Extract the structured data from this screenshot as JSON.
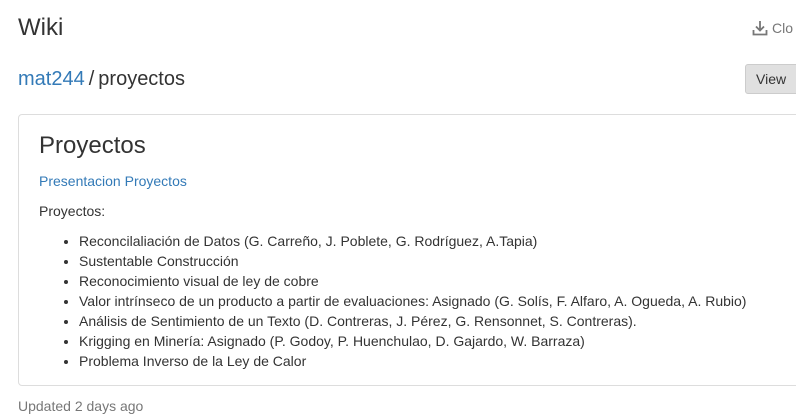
{
  "header": {
    "title": "Wiki",
    "clone_label": "Clo"
  },
  "breadcrumb": {
    "repo": "mat244",
    "separator": "/",
    "page": "proyectos"
  },
  "toolbar": {
    "view_label": "View"
  },
  "content": {
    "title": "Proyectos",
    "link_text": "Presentacion Proyectos",
    "intro": "Proyectos:",
    "items": [
      "Reconcilaliación de Datos (G. Carreño, J. Poblete, G. Rodríguez, A.Tapia)",
      "Sustentable Construcción",
      "Reconocimiento visual de ley de cobre",
      "Valor intrínseco de un producto a partir de evaluaciones: Asignado (G. Solís, F. Alfaro, A. Ogueda, A. Rubio)",
      "Análisis de Sentimiento de un Texto (D. Contreras, J. Pérez, G. Rensonnet, S. Contreras).",
      "Krigging en Minería: Asignado (P. Godoy, P. Huenchulao, D. Gajardo, W. Barraza)",
      "Problema Inverso de la Ley de Calor"
    ]
  },
  "footer": {
    "updated": "Updated 2 days ago"
  },
  "colors": {
    "link": "#337ab7",
    "muted": "#777777",
    "button_bg": "#e0e0e0"
  }
}
